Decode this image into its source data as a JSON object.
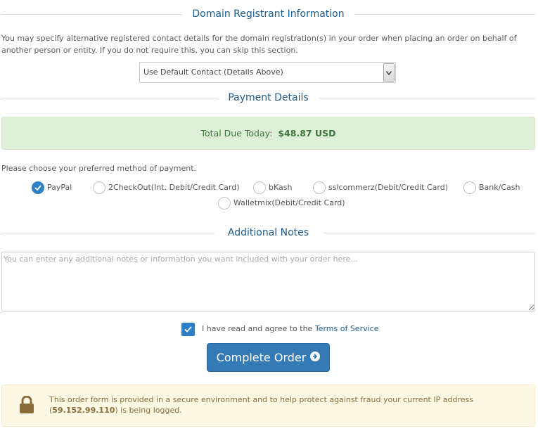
{
  "registrant": {
    "title": "Domain Registrant Information",
    "description": "You may specify alternative registered contact details for the domain registration(s) in your order when placing an order on behalf of another person or entity. If you do not require this, you can skip this section.",
    "contact_select_value": "Use Default Contact (Details Above)"
  },
  "payment": {
    "title": "Payment Details",
    "total_label": "Total Due Today:",
    "total_amount": "$48.87 USD",
    "choose_text": "Please choose your preferred method of payment.",
    "methods": [
      {
        "label": "PayPal",
        "checked": true
      },
      {
        "label": "2CheckOut(Int. Debit/Credit Card)",
        "checked": false
      },
      {
        "label": "bKash",
        "checked": false
      },
      {
        "label": "sslcommerz(Debit/Credit Card)",
        "checked": false
      },
      {
        "label": "Bank/Cash",
        "checked": false
      },
      {
        "label": "Walletmix(Debit/Credit Card)",
        "checked": false
      }
    ]
  },
  "notes": {
    "title": "Additional Notes",
    "placeholder": "You can enter any additional notes or information you want included with your order here..."
  },
  "tos": {
    "checked": true,
    "text": "I have read and agree to the",
    "link": "Terms of Service"
  },
  "complete_button": "Complete Order",
  "security": {
    "text_before": "This order form is provided in a secure environment and to help protect against fraud your current IP address (",
    "ip": "59.152.99.110",
    "text_after": ") is being logged."
  },
  "colors": {
    "accent": "#337ab7",
    "heading": "#1d5b8c",
    "success_bg": "#dff0d8",
    "warning_bg": "#fcf8e3"
  },
  "icons": {
    "select": "chevron-down-icon",
    "radio_checked": "check-icon",
    "button": "arrow-circle-right-icon",
    "security": "lock-icon"
  }
}
